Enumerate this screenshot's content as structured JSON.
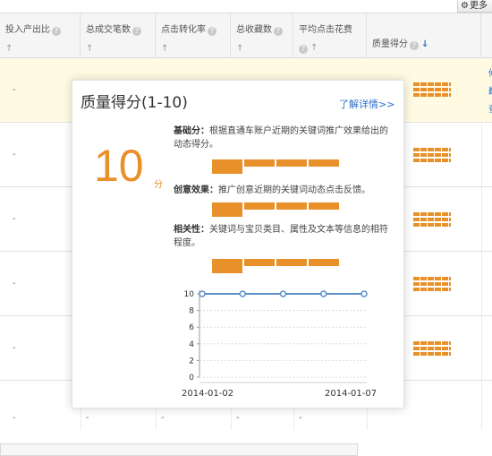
{
  "toolbar": {
    "more_label": "更多"
  },
  "table": {
    "headers": [
      {
        "label": "投入产出比"
      },
      {
        "label": "总成交笔数"
      },
      {
        "label": "点击转化率"
      },
      {
        "label": "总收藏数"
      },
      {
        "label": "平均点击花费"
      },
      {
        "label": "质量得分"
      }
    ],
    "dash": "-",
    "edge_chars": [
      "修",
      "翻",
      "查"
    ]
  },
  "popup": {
    "title": "质量得分(1-10)",
    "link": "了解详情>>",
    "score": "10",
    "score_unit": "分",
    "metrics": [
      {
        "label": "基础分：",
        "text": "根据直通车账户近期的关键词推广效果给出的动态得分。"
      },
      {
        "label": "创意效果：",
        "text": "推广创意近期的关键词动态点击反馈。"
      },
      {
        "label": "相关性：",
        "text": "关键词与宝贝类目、属性及文本等信息的相符程度。"
      }
    ]
  },
  "chart_data": {
    "type": "line",
    "x": [
      "2014-01-02",
      "2014-01-03",
      "2014-01-04",
      "2014-01-05",
      "2014-01-07"
    ],
    "x_tick_labels": [
      "2014-01-02",
      "2014-01-07"
    ],
    "series": [
      {
        "values": [
          10,
          10,
          10,
          10,
          10
        ]
      }
    ],
    "y_ticks": [
      0,
      2,
      4,
      6,
      8,
      10
    ],
    "ylim": [
      0,
      10
    ],
    "grid": true,
    "color": "#5b8fc7"
  }
}
